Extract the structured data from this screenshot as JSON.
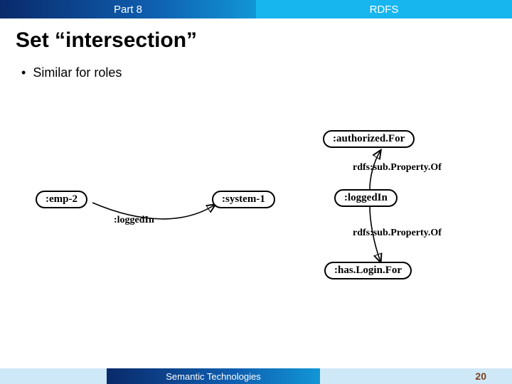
{
  "header": {
    "left": "Part 8",
    "right": "RDFS"
  },
  "title": "Set “intersection”",
  "bullet1": "Similar for roles",
  "diagram": {
    "nodes": {
      "emp2": ":emp-2",
      "system1": ":system-1",
      "authorizedFor": ":authorized.For",
      "loggedIn": ":loggedIn",
      "hasLoginFor": ":has.Login.For"
    },
    "edges": {
      "loggedIn_emp_system": ":loggedIn",
      "subPropOf_upper": "rdfs:sub.Property.Of",
      "subPropOf_lower": "rdfs:sub.Property.Of"
    }
  },
  "footer": {
    "center": "Semantic Technologies",
    "page": "20"
  }
}
